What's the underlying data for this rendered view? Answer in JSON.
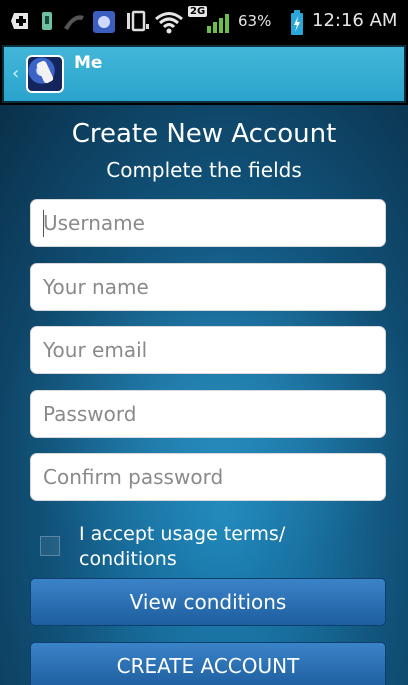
{
  "status_bar": {
    "battery_percent": "63%",
    "network_badge": "2G",
    "time": "12:16 AM",
    "icons": [
      "add-icon",
      "usb-icon",
      "phone-icon",
      "app-notification-icon",
      "vibrate-icon",
      "wifi-icon",
      "signal-icon",
      "battery-charging-icon"
    ]
  },
  "app_bar": {
    "title": "Me",
    "icon": "app-logo-icon"
  },
  "form": {
    "title": "Create New Account",
    "subtitle": "Complete the fields",
    "fields": {
      "username": {
        "placeholder": "Username",
        "value": ""
      },
      "name": {
        "placeholder": "Your name",
        "value": ""
      },
      "email": {
        "placeholder": "Your email",
        "value": ""
      },
      "password": {
        "placeholder": "Password",
        "value": ""
      },
      "confirm_password": {
        "placeholder": "Confirm password",
        "value": ""
      }
    },
    "terms_label": "I accept usage terms/ conditions",
    "terms_checked": false,
    "view_conditions_label": "View conditions",
    "create_account_label": "CREATE ACCOUNT"
  },
  "colors": {
    "action_bar": "#2aa3cc",
    "button": "#2a6fb3",
    "background": "#186f9f"
  }
}
